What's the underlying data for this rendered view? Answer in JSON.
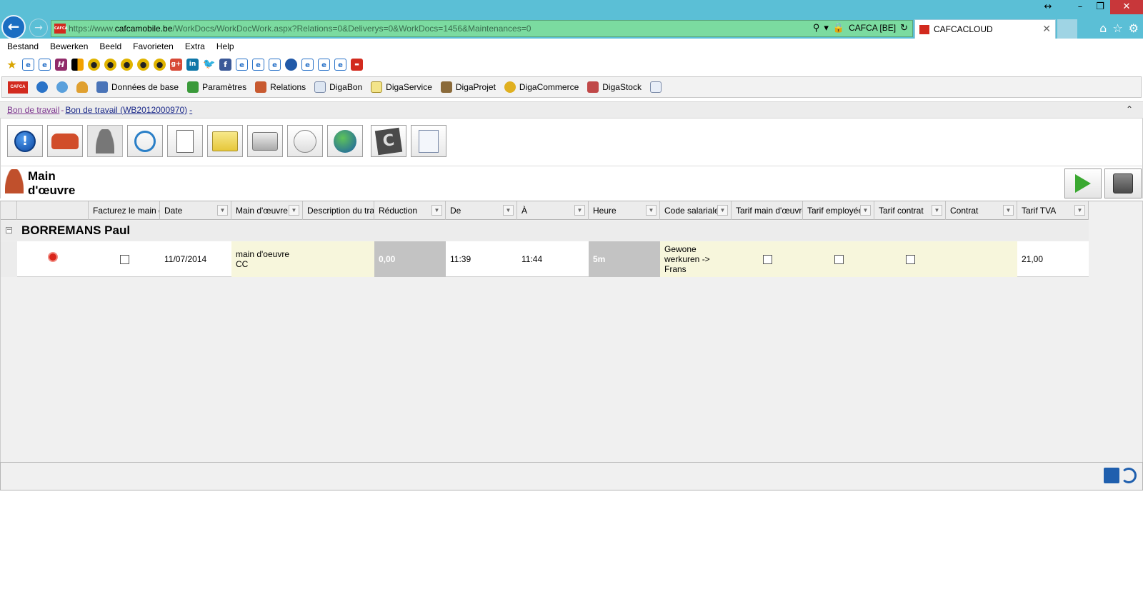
{
  "browser": {
    "url_scheme": "https://www.",
    "url_host": "cafcamobile.be",
    "url_rest": "/WorkDocs/WorkDocWork.aspx?Relations=0&Deliverys=0&WorkDocs=1456&Maintenances=0",
    "security_label": "CAFCA [BE]",
    "tab_title": "CAFCACLOUD"
  },
  "menu": [
    "Bestand",
    "Bewerken",
    "Beeld",
    "Favorieten",
    "Extra",
    "Help"
  ],
  "app_toolbar": {
    "items": [
      {
        "label": "Données de base",
        "icon": "database-icon"
      },
      {
        "label": "Paramètres",
        "icon": "settings-icon"
      },
      {
        "label": "Relations",
        "icon": "relations-icon"
      },
      {
        "label": "DigaBon",
        "icon": "digabon-icon"
      },
      {
        "label": "DigaService",
        "icon": "digaservice-icon"
      },
      {
        "label": "DigaProjet",
        "icon": "digaprojet-icon"
      },
      {
        "label": "DigaCommerce",
        "icon": "digacommerce-icon"
      },
      {
        "label": "DigaStock",
        "icon": "digastock-icon"
      }
    ]
  },
  "breadcrumb": {
    "first": "Bon de travail",
    "separator": "-",
    "second": "Bon de travail (WB2012000970)",
    "trailing": "-"
  },
  "section": {
    "title_line1": "Main",
    "title_line2": "d'œuvre"
  },
  "grid": {
    "columns": [
      "Facturez le main d'œuvre",
      "Date",
      "Main d'œuvre",
      "Description du travail",
      "Réduction",
      "De",
      "À",
      "Heure",
      "Code salariale",
      "Tarif main d'œuvre",
      "Tarif employée",
      "Tarif contrat",
      "Contrat",
      "Tarif TVA"
    ],
    "group_name": "BORREMANS Paul",
    "rows": [
      {
        "invoice": false,
        "date": "11/07/2014",
        "labour_line1": "main d'oeuvre",
        "labour_line2": "CC",
        "description": "",
        "reduction": "0,00",
        "from": "11:39",
        "to": "11:44",
        "hours": "5m",
        "wage_code_line1": "Gewone",
        "wage_code_line2": "werkuren ->",
        "wage_code_line3": "Frans",
        "labour_rate": false,
        "employee_rate": false,
        "contract_rate": false,
        "contract": "",
        "vat_rate": "21,00"
      }
    ]
  }
}
